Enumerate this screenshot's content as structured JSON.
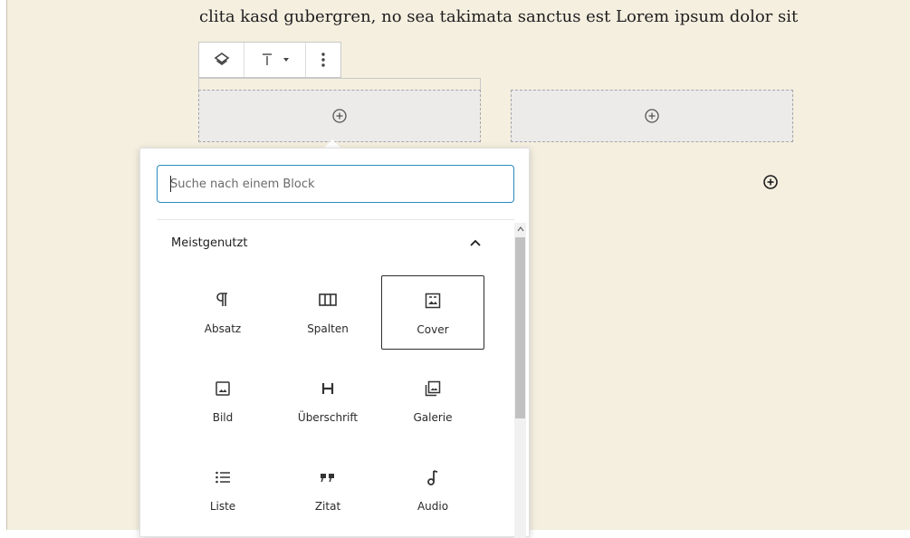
{
  "editor": {
    "paragraph_text": "clita kasd gubergren, no sea takimata sanctus est Lorem ipsum dolor sit"
  },
  "toolbar": {
    "buttons": [
      {
        "icon": "parent-block-icon"
      },
      {
        "icon": "align-top-icon"
      },
      {
        "icon": "more-options-icon"
      }
    ]
  },
  "columns": [
    {
      "icon": "add-block-icon"
    },
    {
      "icon": "add-block-icon"
    }
  ],
  "inserter": {
    "search_placeholder": "Suche nach einem Block",
    "section_title": "Meistgenutzt",
    "blocks": [
      {
        "label": "Absatz",
        "icon": "paragraph-icon"
      },
      {
        "label": "Spalten",
        "icon": "columns-icon"
      },
      {
        "label": "Cover",
        "icon": "cover-icon",
        "selected": true
      },
      {
        "label": "Bild",
        "icon": "image-icon"
      },
      {
        "label": "Überschrift",
        "icon": "heading-icon"
      },
      {
        "label": "Galerie",
        "icon": "gallery-icon"
      },
      {
        "label": "Liste",
        "icon": "list-icon"
      },
      {
        "label": "Zitat",
        "icon": "quote-icon"
      },
      {
        "label": "Audio",
        "icon": "audio-icon"
      }
    ]
  },
  "colors": {
    "canvas": "#f5efe0",
    "focus": "#2a8bbd",
    "placeholder_bg": "#ecebea"
  }
}
